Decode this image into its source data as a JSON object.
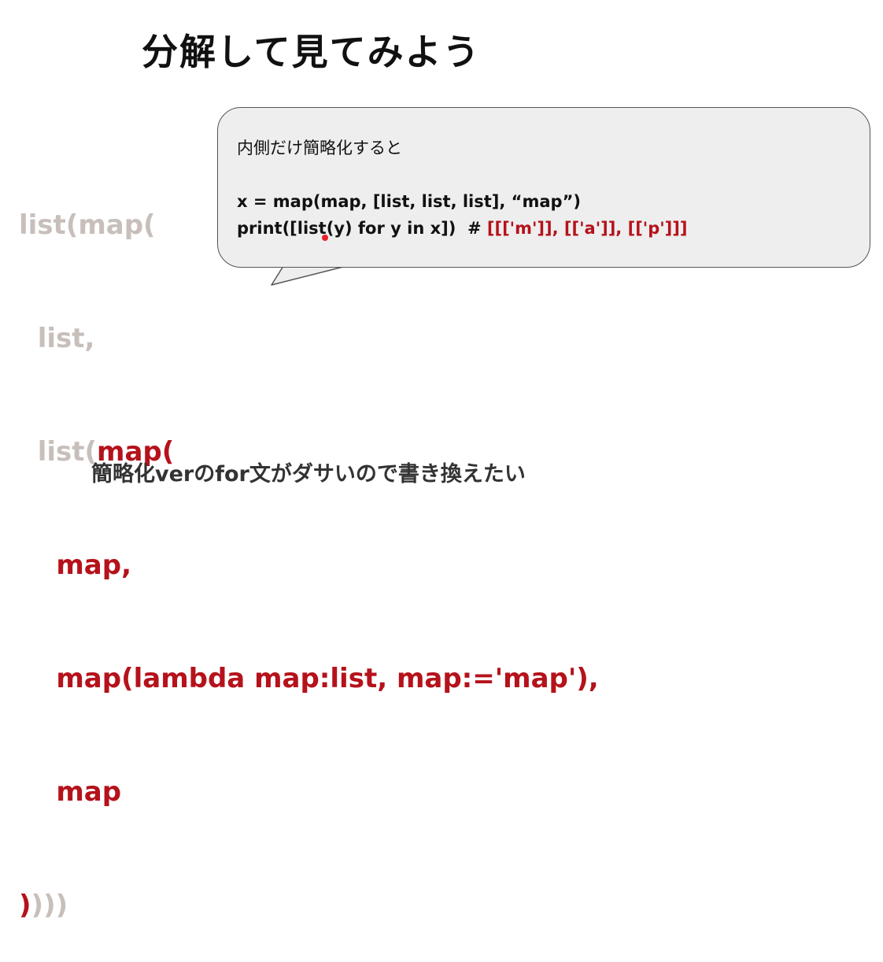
{
  "slide": {
    "title": "分解して見てみよう",
    "footer": "簡略化verのfor文がダサいので書き換えたい"
  },
  "code_block": {
    "line1": "list(map(",
    "line2": "list,",
    "line3_gray": "list(",
    "line3_red": "map(",
    "line4": "map,",
    "line5": "map(lambda map:list, map:='map'),",
    "line6": "map",
    "line7_red": ")",
    "line7_gray": ")))"
  },
  "bubble": {
    "heading": "内側だけ簡略化すると",
    "code_line1": "x = map(map, [list, list, list], “map”)",
    "code_line2": "print([list(y) for y in x])  # ",
    "code_line2_comment": "[[['m']], [['a']], [['p']]]"
  },
  "colors": {
    "accent_red": "#b5121b",
    "faded_gray": "#c8bfba",
    "bubble_bg": "#eeeeee",
    "cursor_red": "#e8202a"
  }
}
